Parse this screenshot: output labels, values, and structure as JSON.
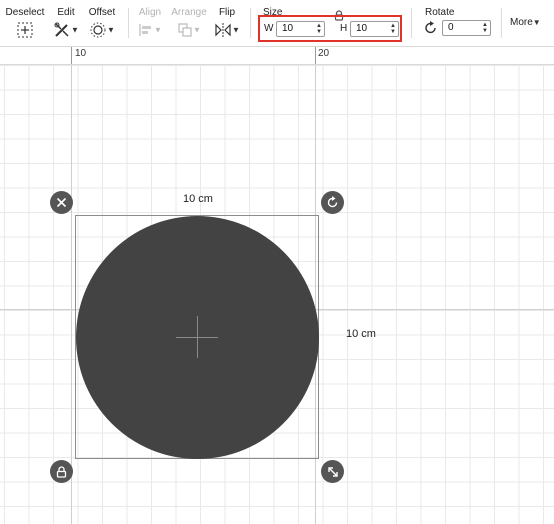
{
  "toolbar": {
    "deselect": {
      "label": "Deselect",
      "icon": "deselect-icon"
    },
    "edit": {
      "label": "Edit",
      "icon": "edit-icon"
    },
    "offset": {
      "label": "Offset",
      "icon": "offset-icon"
    },
    "align": {
      "label": "Align",
      "icon": "align-icon",
      "disabled": true
    },
    "arrange": {
      "label": "Arrange",
      "icon": "arrange-icon",
      "disabled": true
    },
    "flip": {
      "label": "Flip",
      "icon": "flip-icon"
    },
    "size": {
      "label": "Size",
      "width_label": "W",
      "width_value": "10",
      "height_label": "H",
      "height_value": "10",
      "lock_icon": "lock-icon",
      "highlight_color": "#e0342b"
    },
    "rotate": {
      "label": "Rotate",
      "value": "0",
      "icon": "rotate-icon"
    },
    "more": {
      "label": "More"
    }
  },
  "ruler": {
    "marks": [
      "10",
      "20"
    ]
  },
  "canvas": {
    "shape": {
      "type": "circle",
      "fill": "#434343"
    },
    "width_label": "10 cm",
    "height_label": "10 cm",
    "handles": {
      "delete": "close-icon",
      "rotate": "rotate-icon",
      "lock": "lock-icon",
      "resize": "resize-icon"
    }
  }
}
